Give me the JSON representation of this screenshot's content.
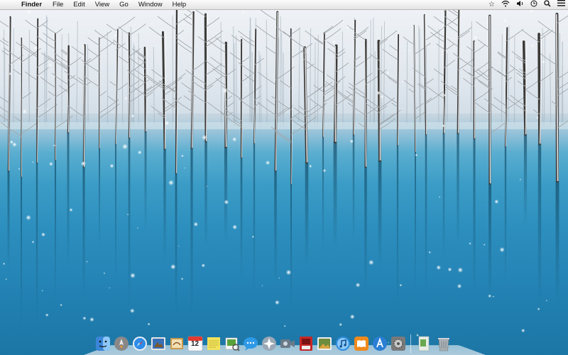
{
  "menubar": {
    "apple_glyph": "",
    "app_name": "Finder",
    "items": [
      "File",
      "Edit",
      "View",
      "Go",
      "Window",
      "Help"
    ],
    "status_icons": [
      "star-icon",
      "wifi-icon",
      "volume-icon",
      "clock-icon",
      "search-icon",
      "list-icon"
    ]
  },
  "desktop": {
    "wallpaper": "snow-frozen-trees-blue-lake",
    "colors": {
      "sky": "#e6ecf1",
      "water": "#2585b6",
      "water_light": "#5aaed0"
    }
  },
  "dock": {
    "icons": [
      {
        "name": "finder-icon",
        "color": "#3b86d8"
      },
      {
        "name": "launchpad-icon",
        "color": "#888888"
      },
      {
        "name": "safari-icon",
        "color": "#2d8ce8"
      },
      {
        "name": "photo-browser-icon",
        "color": "#3a6fb5"
      },
      {
        "name": "mail-stamp-icon",
        "color": "#c99a4c"
      },
      {
        "name": "calendar-icon",
        "color": "#e23a2f",
        "day": "12"
      },
      {
        "name": "stickies-icon",
        "color": "#f2e35c"
      },
      {
        "name": "preview-icon",
        "color": "#5aa23a"
      },
      {
        "name": "messages-icon",
        "color": "#2e9ae8"
      },
      {
        "name": "dashboard-icon",
        "color": "#9aa7b5"
      },
      {
        "name": "facetime-icon",
        "color": "#6b7a88"
      },
      {
        "name": "photo-booth-icon",
        "color": "#c62828"
      },
      {
        "name": "iphoto-icon",
        "color": "#6d8c3d"
      },
      {
        "name": "itunes-icon",
        "color": "#2f8de0"
      },
      {
        "name": "ibooks-icon",
        "color": "#f08a1c"
      },
      {
        "name": "app-store-icon",
        "color": "#2a7fd4"
      },
      {
        "name": "system-preferences-icon",
        "color": "#7a7a7a"
      }
    ],
    "right_icons": [
      {
        "name": "document-stack-icon",
        "color": "#e8ede5"
      },
      {
        "name": "trash-icon",
        "color": "#a9b0b6"
      }
    ]
  }
}
